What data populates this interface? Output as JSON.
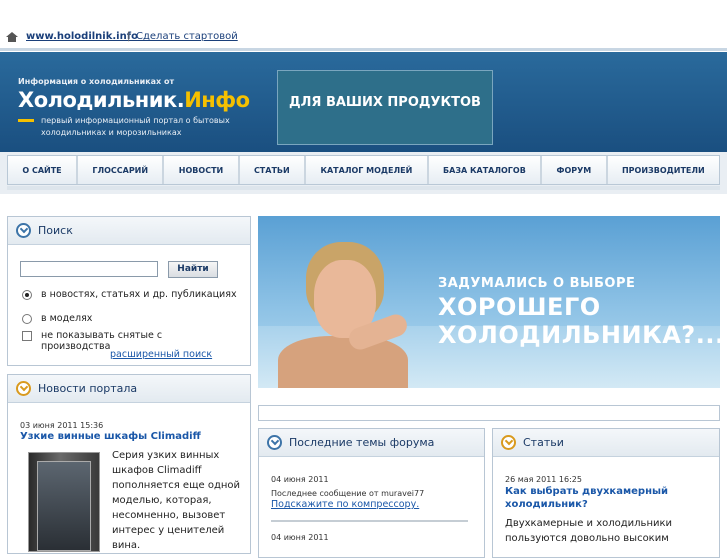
{
  "topbar": {
    "site_link": "www.holodilnik.info",
    "separator": "|",
    "start_link": "Сделать стартовой"
  },
  "header": {
    "tagline": "Информация о холодильниках от",
    "logo_main": "Холодильник.",
    "logo_accent": "Инфо",
    "slogan": "первый информационный портал о бытовых холодильниках и морозильниках",
    "promo": "ДЛЯ ВАШИХ ПРОДУКТОВ"
  },
  "nav": {
    "items": [
      "О САЙТЕ",
      "ГЛОССАРИЙ",
      "НОВОСТИ",
      "СТАТЬИ",
      "КАТАЛОГ МОДЕЛЕЙ",
      "БАЗА КАТАЛОГОВ",
      "ФОРУМ",
      "ПРОИЗВОДИТЕЛИ"
    ]
  },
  "search": {
    "title": "Поиск",
    "input_value": "",
    "button": "Найти",
    "option_news": "в новостях, статьях и др. публикациях",
    "option_models": "в моделях",
    "option_discontinued": "не показывать снятые с производства",
    "advanced_link": "расширенный поиск"
  },
  "news": {
    "title": "Новости портала",
    "date": "03 июня 2011 15:36",
    "headline": "Узкие винные шкафы Climadiff",
    "text": "Серия узких винных шкафов Climadiff пополняется еще одной моделью, которая, несомненно, вызовет интерес у ценителей вина."
  },
  "banner": {
    "line1": "ЗАДУМАЛИСЬ О ВЫБОРЕ",
    "line2": "ХОРОШЕГО",
    "line3": "ХОЛОДИЛЬНИКА?..."
  },
  "forum": {
    "title": "Последние темы форума",
    "date1": "04 июня 2011",
    "last_message": "Последнее сообщение от muravei77",
    "topic_link": "Подскажите по компрессору.",
    "date2": "04 июня 2011"
  },
  "articles": {
    "title": "Статьи",
    "date": "26 мая 2011 16:25",
    "headline": "Как выбрать двухкамерный холодильник?",
    "text": "Двухкамерные и холодильники пользуются довольно высоким"
  }
}
